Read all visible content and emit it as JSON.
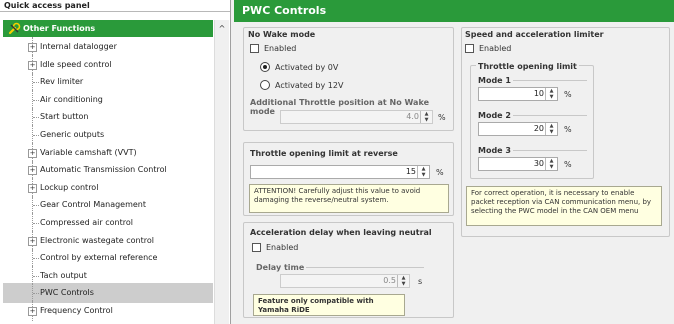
{
  "quick_access_panel": {
    "title": "Quick access panel",
    "section_title": "Other Functions",
    "scroll_up_glyph": "^",
    "items": [
      {
        "label": "Internal datalogger",
        "expandable": true
      },
      {
        "label": "Idle speed control",
        "expandable": true
      },
      {
        "label": "Rev limiter",
        "expandable": false
      },
      {
        "label": "Air conditioning",
        "expandable": false
      },
      {
        "label": "Start button",
        "expandable": false
      },
      {
        "label": "Generic outputs",
        "expandable": false
      },
      {
        "label": "Variable camshaft (VVT)",
        "expandable": true
      },
      {
        "label": "Automatic Transmission Control",
        "expandable": true
      },
      {
        "label": "Lockup control",
        "expandable": true
      },
      {
        "label": "Gear Control Management",
        "expandable": false
      },
      {
        "label": "Compressed air control",
        "expandable": false
      },
      {
        "label": "Electronic wastegate control",
        "expandable": true
      },
      {
        "label": "Control by external reference",
        "expandable": false
      },
      {
        "label": "Tach output",
        "expandable": false
      },
      {
        "label": "PWC Controls",
        "expandable": false,
        "selected": true
      },
      {
        "label": "Frequency Control",
        "expandable": true
      }
    ]
  },
  "main": {
    "title": "PWC Controls",
    "no_wake": {
      "title": "No Wake mode",
      "enabled_label": "Enabled",
      "radio_0v": "Activated by 0V",
      "radio_12v": "Activated by 12V",
      "throttle_label": "Additional Throttle position at No Wake mode",
      "throttle_value": "4.0",
      "throttle_unit": "%"
    },
    "reverse": {
      "title": "Throttle opening limit at reverse",
      "value": "15",
      "unit": "%",
      "note": "ATTENTION! Carefully adjust this value to avoid damaging the reverse/neutral system."
    },
    "accel_delay": {
      "title": "Acceleration delay when leaving neutral",
      "enabled_label": "Enabled",
      "delay_label": "Delay time",
      "delay_value": "0.5",
      "delay_unit": "s",
      "note": "Feature only compatible with Yamaha RiDE"
    },
    "speed_limiter": {
      "title": "Speed and acceleration limiter",
      "enabled_label": "Enabled",
      "throttle_group_title": "Throttle opening limit",
      "modes": [
        {
          "label": "Mode 1",
          "value": "10",
          "unit": "%"
        },
        {
          "label": "Mode 2",
          "value": "20",
          "unit": "%"
        },
        {
          "label": "Mode 3",
          "value": "30",
          "unit": "%"
        }
      ],
      "note": "For correct operation, it is necessary to enable packet reception via CAN communication menu, by selecting the PWC model in the CAN OEM menu"
    },
    "spin_up": "▲",
    "spin_down": "▼"
  },
  "colors": {
    "accent_green": "#2a9a3a",
    "note_bg": "#ffffe1",
    "selected_row": "#cdcdcd"
  },
  "icons": {
    "section": "wrench-icon",
    "expand": "plus-box-icon"
  }
}
